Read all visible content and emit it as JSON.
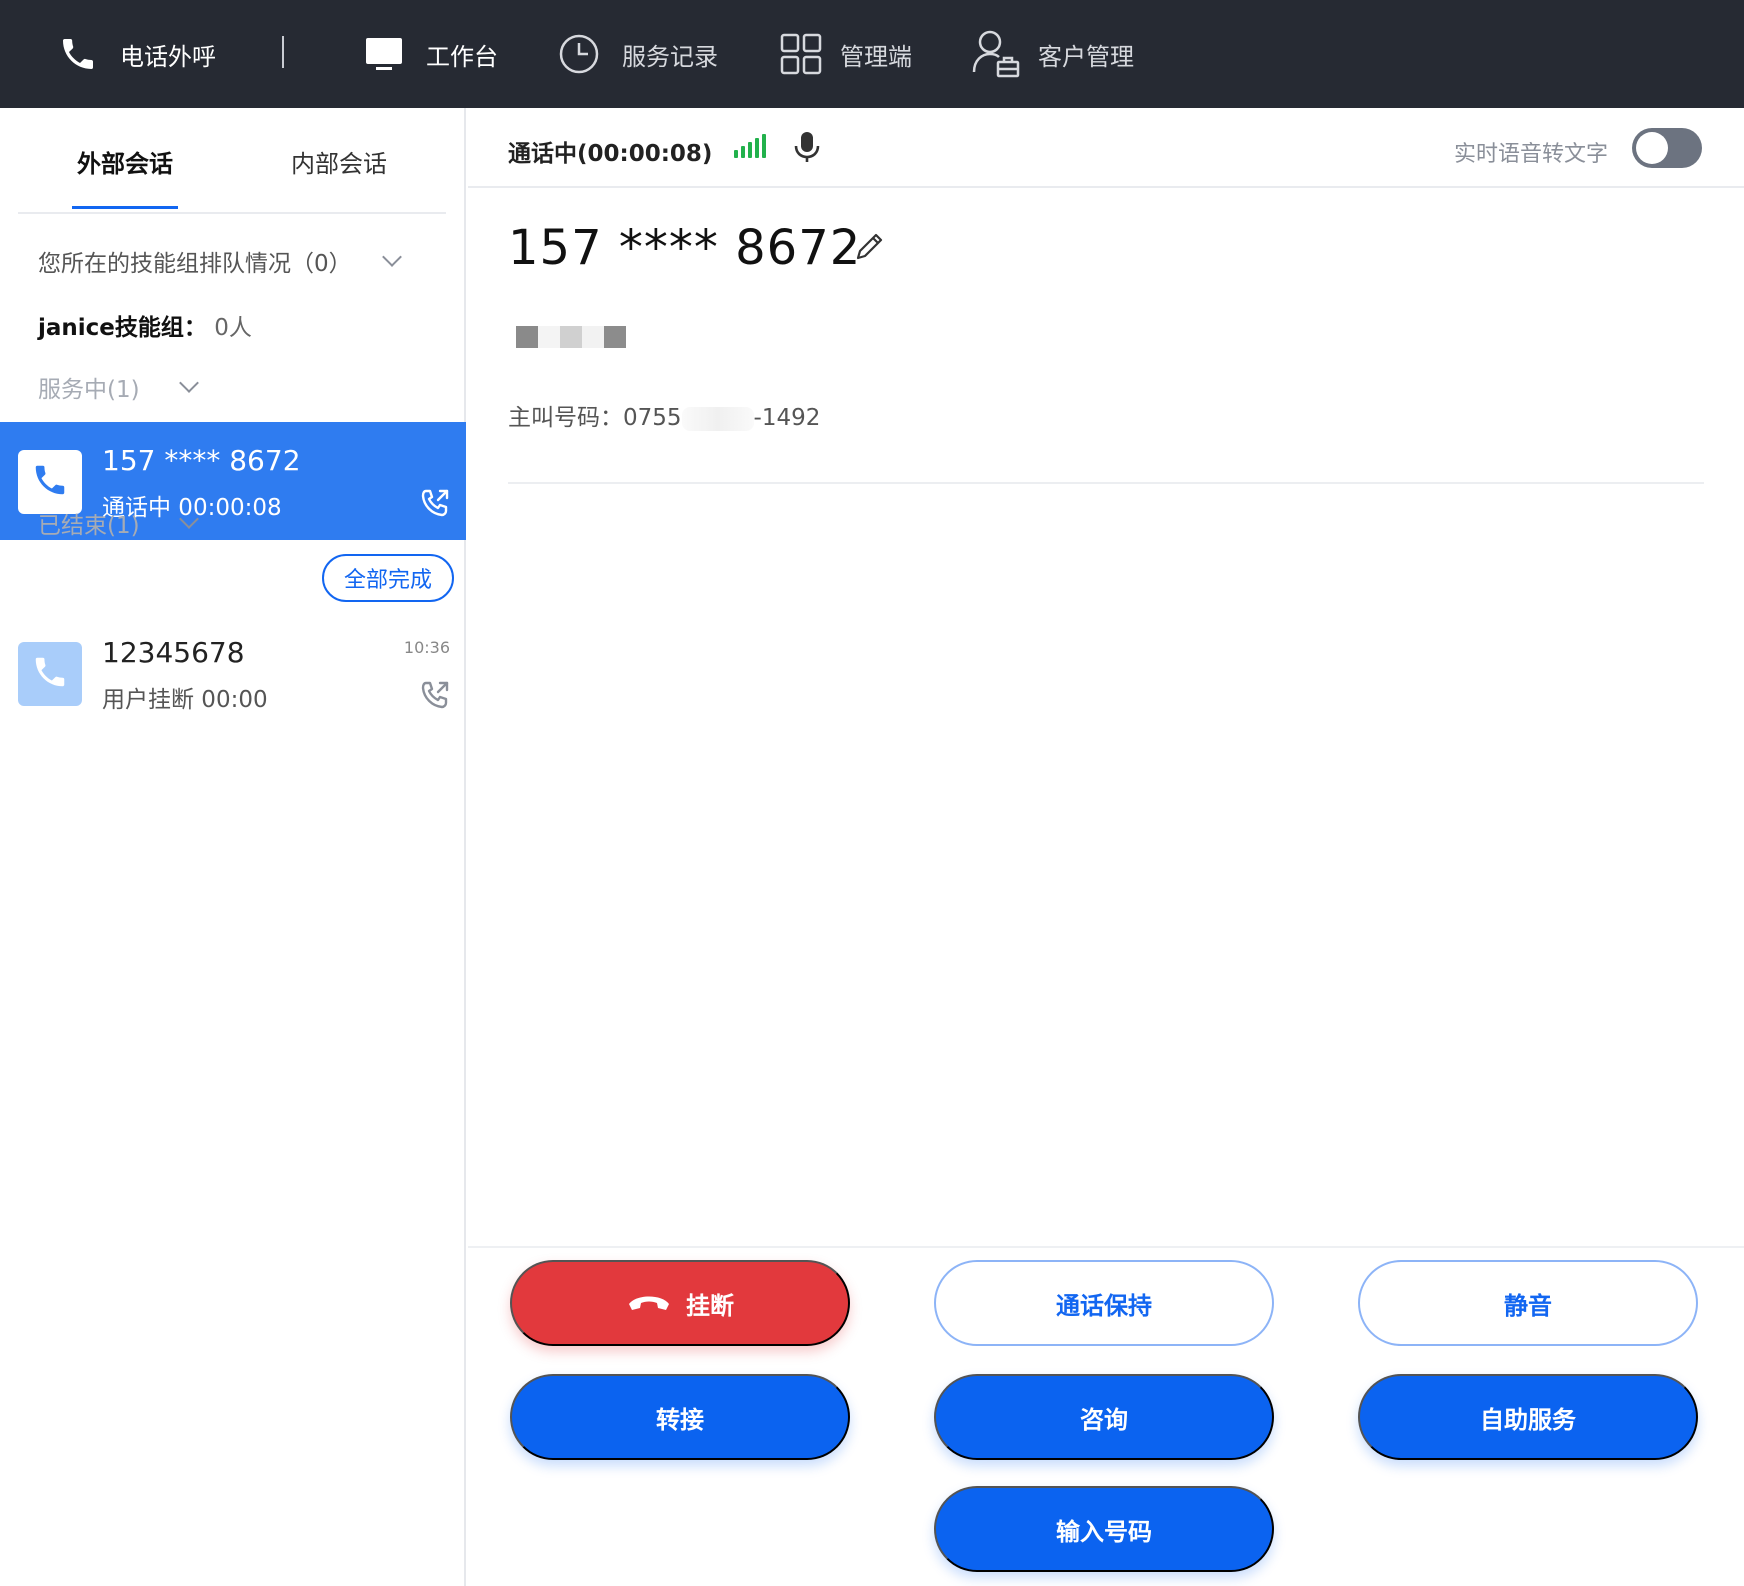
{
  "topbar": {
    "outbound_label": "电话外呼",
    "nav": [
      {
        "label": "工作台",
        "icon": "monitor-icon"
      },
      {
        "label": "服务记录",
        "icon": "clock-icon"
      },
      {
        "label": "管理端",
        "icon": "grid-icon"
      },
      {
        "label": "客户管理",
        "icon": "customer-icon"
      }
    ]
  },
  "left": {
    "tabs": [
      {
        "label": "外部会话",
        "active": true
      },
      {
        "label": "内部会话",
        "active": false
      }
    ],
    "queue_title": "您所在的技能组排队情况（0）",
    "group_name": "janice技能组",
    "group_sep": "：",
    "group_value": "0人",
    "in_service_label": "服务中(1)",
    "ended_label": "已结束(1)",
    "complete_all_label": "全部完成",
    "active_call": {
      "number": "157 **** 8672",
      "status": "通话中 00:00:08"
    },
    "ended_call": {
      "number": "12345678",
      "status": "用户挂断 00:00",
      "time": "10:36"
    }
  },
  "right": {
    "call_status": "通话中(00:00:08)",
    "stt_label": "实时语音转文字",
    "stt_enabled": false,
    "number": "157 **** 8672",
    "caller_label": "主叫号码：",
    "caller_prefix": "0755",
    "caller_suffix": "-1492",
    "buttons": {
      "hangup": "挂断",
      "hold": "通话保持",
      "mute": "静音",
      "transfer": "转接",
      "consult": "咨询",
      "self_service": "自助服务",
      "dial": "输入号码"
    }
  },
  "colors": {
    "topbar_bg": "#262a33",
    "accent": "#1266f1",
    "active_item": "#2f7cf0",
    "danger": "#e2393d",
    "signal": "#22b14c"
  }
}
